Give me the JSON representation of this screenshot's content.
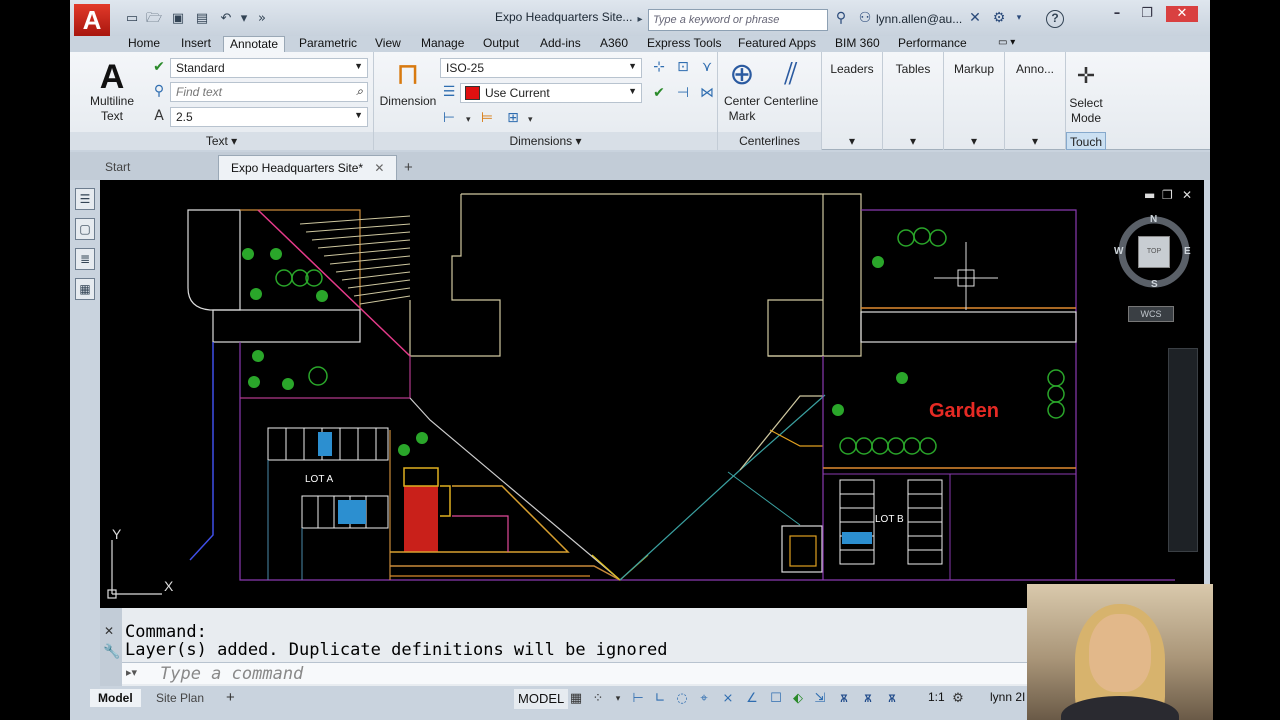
{
  "window": {
    "title": "Expo Headquarters Site...",
    "search_placeholder": "Type a keyword or phrase",
    "user": "lynn.allen@au...",
    "logo": "A",
    "help": "?"
  },
  "ribbon_tabs": [
    "Home",
    "Insert",
    "Annotate",
    "Parametric",
    "View",
    "Manage",
    "Output",
    "Add-ins",
    "A360",
    "Express Tools",
    "Featured Apps",
    "BIM 360",
    "Performance"
  ],
  "active_tab": "Annotate",
  "text_panel": {
    "label": "Text",
    "big_button_line1": "Multiline",
    "big_button_line2": "Text",
    "style": "Standard",
    "find_placeholder": "Find text",
    "height": "2.5"
  },
  "dimensions_panel": {
    "label": "Dimensions",
    "big_button": "Dimension",
    "dim_style": "ISO-25",
    "layer": "Use Current",
    "layer_color": "#e01010"
  },
  "centerlines_panel": {
    "label": "Centerlines",
    "center_mark_line1": "Center",
    "center_mark_line2": "Mark",
    "centerline": "Centerline"
  },
  "collapsed_panels": [
    "Leaders",
    "Tables",
    "Markup",
    "Anno..."
  ],
  "touch_panel": {
    "label": "Touch",
    "select_line1": "Select",
    "select_line2": "Mode"
  },
  "file_tabs": {
    "start": "Start",
    "doc": "Expo Headquarters Site*",
    "add": "+"
  },
  "drawing": {
    "garden_label": "Garden",
    "lot_a": "LOT A",
    "lot_b": "LOT B",
    "ucs_x": "X",
    "ucs_y": "Y"
  },
  "viewcube": {
    "north": "N",
    "south": "S",
    "east": "E",
    "west": "W",
    "top": "TOP",
    "wcs": "WCS"
  },
  "command": {
    "history": [
      "Command:",
      "Layer(s) added. Duplicate definitions will be ignored"
    ],
    "placeholder": "Type a command"
  },
  "status": {
    "model_tab": "Model",
    "layout_tab": "Site Plan",
    "add": "+",
    "model_space": "MODEL",
    "scale": "1:1",
    "user": "lynn 2I"
  },
  "colors": {
    "accent_red": "#e52a24",
    "tab_bg": "#c9d3de",
    "canvas_bg": "#000000"
  }
}
